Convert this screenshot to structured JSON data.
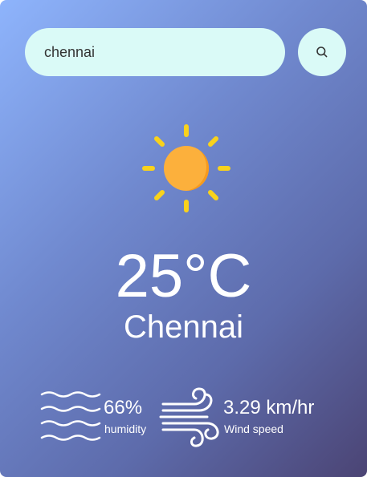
{
  "search": {
    "value": "chennai",
    "button_icon": "search-icon"
  },
  "weather": {
    "icon": "sun-icon",
    "temperature": "25°C",
    "city": "Chennai"
  },
  "details": {
    "humidity": {
      "icon": "humidity-waves-icon",
      "value": "66%",
      "label": "humidity"
    },
    "wind": {
      "icon": "wind-icon",
      "value": "3.29 km/hr",
      "label": "Wind speed"
    }
  },
  "colors": {
    "gradient_start": "#8eb4fc",
    "gradient_end": "#4b4474",
    "input_background": "#dafaf7",
    "sun_body": "#fcb03c",
    "sun_rays": "#f9d21c"
  }
}
